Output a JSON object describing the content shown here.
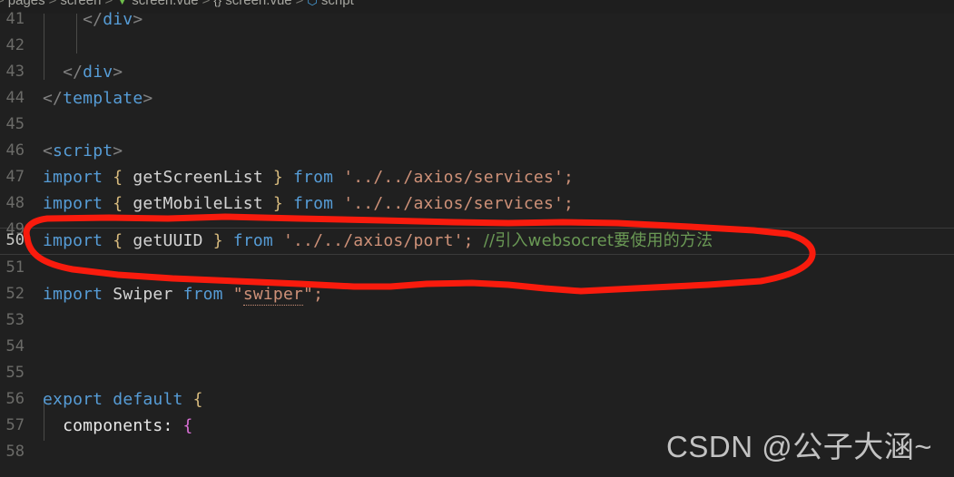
{
  "window": {
    "app": "vscode-editor",
    "background": "#202020"
  },
  "breadcrumb": {
    "name": "breadcrumb",
    "separator": ">",
    "segments": [
      {
        "label": "pages",
        "icon": ""
      },
      {
        "label": "screen",
        "icon": ""
      },
      {
        "label": "screen.vue",
        "icon": "vue-file-icon",
        "glyph": "▼"
      },
      {
        "label": "screen.vue",
        "icon": "object-icon",
        "glyph": "{}"
      },
      {
        "label": "script",
        "icon": "script-symbol-icon",
        "glyph": "⬡"
      }
    ]
  },
  "editor": {
    "current_line": 50,
    "first_visible_line": 41,
    "last_visible_line": 58,
    "lines": [
      {
        "n": "41",
        "text": "    </div>"
      },
      {
        "n": "42",
        "text": ""
      },
      {
        "n": "43",
        "text": "  </div>"
      },
      {
        "n": "44",
        "text": "</template>"
      },
      {
        "n": "45",
        "text": ""
      },
      {
        "n": "46",
        "text": "<script>"
      },
      {
        "n": "47",
        "text": "import { getScreenList } from '../../axios/services';"
      },
      {
        "n": "48",
        "text": "import { getMobileList } from '../../axios/services';"
      },
      {
        "n": "49",
        "text": ""
      },
      {
        "n": "50",
        "text": "import { getUUID } from '../../axios/port'; //引入websocret要使用的方法"
      },
      {
        "n": "51",
        "text": ""
      },
      {
        "n": "52",
        "text": "import Swiper from \"swiper\";"
      },
      {
        "n": "53",
        "text": ""
      },
      {
        "n": "54",
        "text": ""
      },
      {
        "n": "55",
        "text": ""
      },
      {
        "n": "56",
        "text": "export default {"
      },
      {
        "n": "57",
        "text": "  components: {"
      },
      {
        "n": "58",
        "text": ""
      }
    ],
    "tokens": {
      "keyword_import": "import",
      "keyword_from": "from",
      "keyword_export": "export",
      "keyword_default": "default",
      "brace_open": "{",
      "brace_close": "}",
      "semicolon": ";",
      "ident_getScreenList": "getScreenList",
      "ident_getMobileList": "getMobileList",
      "ident_getUUID": "getUUID",
      "ident_Swiper": "Swiper",
      "prop_components": "components:",
      "str_services": "'../../axios/services';",
      "str_port": "'../../axios/port';",
      "str_swiper_open": "\"",
      "str_swiper_name": "swiper",
      "str_swiper_close": "\";",
      "comment_line50": "//引入websocret要使用的方法",
      "close_div": "</div>",
      "close_template": "</template>",
      "open_script": "<script>"
    },
    "colors": {
      "keyword": "#569cd6",
      "string": "#ce9178",
      "comment": "#6a9955",
      "brace_yellow": "#d7ba7d",
      "brace_magenta": "#da70d6",
      "identifier": "#d4d4d4",
      "line_number": "#6b6b68",
      "line_number_active": "#c8c8c4",
      "background": "#202020"
    }
  },
  "annotation": {
    "name": "red-hand-drawn-ellipse",
    "color": "#f91b0d",
    "stroke_width": 7,
    "target_line": 50
  },
  "watermark": {
    "text": "CSDN @公子大涵~",
    "color": "#d0d0d0"
  }
}
